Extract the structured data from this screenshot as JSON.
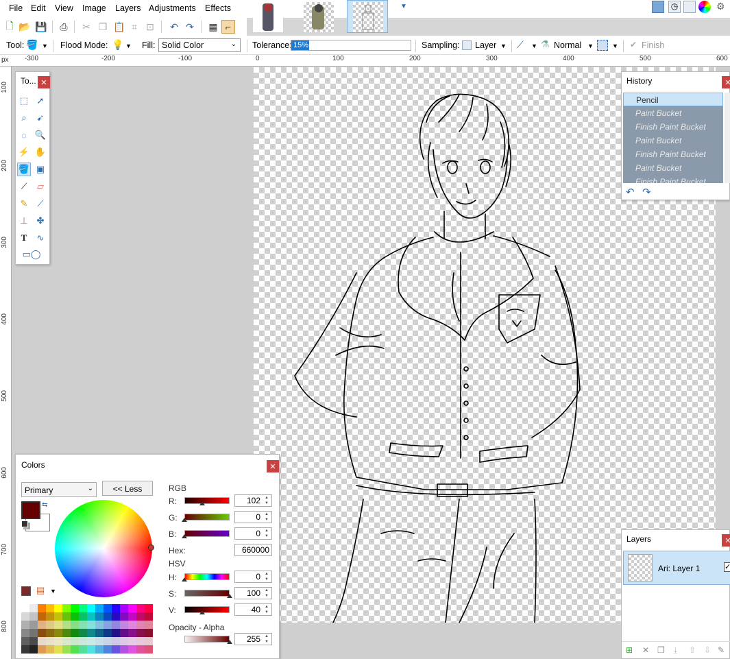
{
  "menu": [
    "File",
    "Edit",
    "View",
    "Image",
    "Layers",
    "Adjustments",
    "Effects"
  ],
  "toolbar2": {
    "tool_label": "Tool:",
    "flood_mode_label": "Flood Mode:",
    "fill_label": "Fill:",
    "fill_value": "Solid Color",
    "tolerance_label": "Tolerance:",
    "tolerance_value": "15%",
    "tolerance_fraction": 0.15,
    "sampling_label": "Sampling:",
    "sampling_value": "Layer",
    "blend_value": "Normal",
    "finish_label": "Finish"
  },
  "ruler": {
    "unit": "px",
    "top_ticks": [
      "-300",
      "-200",
      "-100",
      "0",
      "100",
      "200",
      "300",
      "400",
      "500",
      "600"
    ],
    "left_ticks": [
      "100",
      "200",
      "300",
      "400",
      "500",
      "600",
      "700",
      "800"
    ]
  },
  "tools_panel": {
    "title": "To..."
  },
  "history": {
    "title": "History",
    "items": [
      "Pencil",
      "Paint Bucket",
      "Finish Paint Bucket",
      "Paint Bucket",
      "Finish Paint Bucket",
      "Paint Bucket",
      "Finish Paint Bucket"
    ]
  },
  "layers": {
    "title": "Layers",
    "layer_name": "Ari: Layer 1"
  },
  "colors": {
    "title": "Colors",
    "mode": "Primary",
    "less_button": "<< Less",
    "rgb_label": "RGB",
    "r_label": "R:",
    "r_value": "102",
    "g_label": "G:",
    "g_value": "0",
    "b_label": "B:",
    "b_value": "0",
    "hex_label": "Hex:",
    "hex_value": "660000",
    "hsv_label": "HSV",
    "h_label": "H:",
    "h_value": "0",
    "s_label": "S:",
    "s_value": "100",
    "v_label": "V:",
    "v_value": "40",
    "opacity_label": "Opacity - Alpha",
    "opacity_value": "255",
    "primary_color": "#660000"
  }
}
